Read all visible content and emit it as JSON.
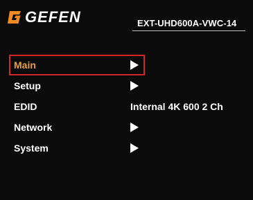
{
  "header": {
    "brand": "GEFEN",
    "model": "EXT-UHD600A-VWC-14"
  },
  "menu": {
    "selected": "Main",
    "items": [
      {
        "label": "Main",
        "value": "",
        "icon": "right-triangle-icon"
      },
      {
        "label": "Setup",
        "value": "",
        "icon": "right-triangle-icon"
      },
      {
        "label": "EDID",
        "value": "Internal 4K 600 2 Ch",
        "icon": ""
      },
      {
        "label": "Network",
        "value": "",
        "icon": "right-triangle-icon"
      },
      {
        "label": "System",
        "value": "",
        "icon": "right-triangle-icon"
      }
    ]
  },
  "colors": {
    "background": "#0b0b0b",
    "selected_text": "#e8a23c",
    "selection_border": "#d0282a",
    "logo_orange": "#f08a24"
  }
}
